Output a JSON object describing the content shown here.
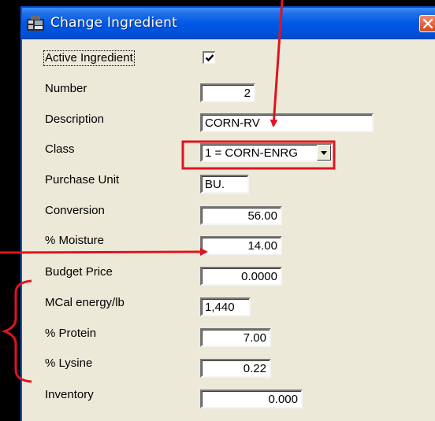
{
  "window": {
    "title": "Change Ingredient",
    "close_icon": "close-icon",
    "app_icon": "ingredient-app-icon"
  },
  "form": {
    "active": {
      "label": "Active Ingredient",
      "checked": true
    },
    "number": {
      "label": "Number",
      "value": "2"
    },
    "description": {
      "label": "Description",
      "value": "CORN-RV"
    },
    "class": {
      "label": "Class",
      "value": "1 = CORN-ENRG"
    },
    "purchase_unit": {
      "label": "Purchase Unit",
      "value": "BU."
    },
    "conversion": {
      "label": "Conversion",
      "value": "56.00"
    },
    "moisture": {
      "label": "% Moisture",
      "value": "14.00"
    },
    "budget_price": {
      "label": "Budget Price",
      "value": "0.0000"
    },
    "mcal": {
      "label": "MCal energy/lb",
      "value": "1,440"
    },
    "protein": {
      "label": "% Protein",
      "value": "7.00"
    },
    "lysine": {
      "label": "% Lysine",
      "value": "0.22"
    },
    "inventory": {
      "label": "Inventory",
      "value": "0.000"
    }
  },
  "colors": {
    "annotation": "#e0141e",
    "titlebar": "#0058e6",
    "dialog_bg": "#ece9d8"
  }
}
